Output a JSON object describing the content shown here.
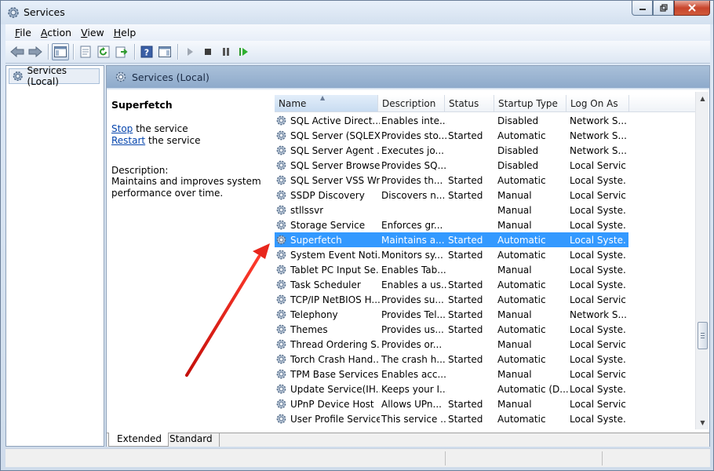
{
  "window": {
    "title": "Services"
  },
  "menu": [
    {
      "label": "File",
      "accel": "F"
    },
    {
      "label": "Action",
      "accel": "A"
    },
    {
      "label": "View",
      "accel": "V"
    },
    {
      "label": "Help",
      "accel": "H"
    }
  ],
  "tree": {
    "root_label": "Services (Local)"
  },
  "content": {
    "header": "Services (Local)"
  },
  "details": {
    "service_name": "Superfetch",
    "stop_link": "Stop",
    "stop_suffix": " the service",
    "restart_link": "Restart",
    "restart_suffix": " the service",
    "description_label": "Description:",
    "description": "Maintains and improves system performance over time."
  },
  "columns": {
    "name": "Name",
    "description": "Description",
    "status": "Status",
    "startup_type": "Startup Type",
    "log_on_as": "Log On As"
  },
  "services": [
    {
      "name": "SQL Active Direct...",
      "description": "Enables inte...",
      "status": "",
      "startup": "Disabled",
      "logon": "Network S..."
    },
    {
      "name": "SQL Server (SQLEX...",
      "description": "Provides sto...",
      "status": "Started",
      "startup": "Automatic",
      "logon": "Network S..."
    },
    {
      "name": "SQL Server Agent ...",
      "description": "Executes jo...",
      "status": "",
      "startup": "Disabled",
      "logon": "Network S..."
    },
    {
      "name": "SQL Server Browser",
      "description": "Provides SQ...",
      "status": "",
      "startup": "Disabled",
      "logon": "Local Service"
    },
    {
      "name": "SQL Server VSS Wr...",
      "description": "Provides th...",
      "status": "Started",
      "startup": "Automatic",
      "logon": "Local Syste..."
    },
    {
      "name": "SSDP Discovery",
      "description": "Discovers n...",
      "status": "Started",
      "startup": "Manual",
      "logon": "Local Service"
    },
    {
      "name": "stllssvr",
      "description": "",
      "status": "",
      "startup": "Manual",
      "logon": "Local Syste..."
    },
    {
      "name": "Storage Service",
      "description": "Enforces gr...",
      "status": "",
      "startup": "Manual",
      "logon": "Local Syste..."
    },
    {
      "name": "Superfetch",
      "description": "Maintains a...",
      "status": "Started",
      "startup": "Automatic",
      "logon": "Local Syste...",
      "selected": true
    },
    {
      "name": "System Event Noti...",
      "description": "Monitors sy...",
      "status": "Started",
      "startup": "Automatic",
      "logon": "Local Syste..."
    },
    {
      "name": "Tablet PC Input Se...",
      "description": "Enables Tab...",
      "status": "",
      "startup": "Manual",
      "logon": "Local Syste..."
    },
    {
      "name": "Task Scheduler",
      "description": "Enables a us...",
      "status": "Started",
      "startup": "Automatic",
      "logon": "Local Syste..."
    },
    {
      "name": "TCP/IP NetBIOS H...",
      "description": "Provides su...",
      "status": "Started",
      "startup": "Automatic",
      "logon": "Local Service"
    },
    {
      "name": "Telephony",
      "description": "Provides Tel...",
      "status": "Started",
      "startup": "Manual",
      "logon": "Network S..."
    },
    {
      "name": "Themes",
      "description": "Provides us...",
      "status": "Started",
      "startup": "Automatic",
      "logon": "Local Syste..."
    },
    {
      "name": "Thread Ordering S...",
      "description": "Provides or...",
      "status": "",
      "startup": "Manual",
      "logon": "Local Service"
    },
    {
      "name": "Torch Crash Hand...",
      "description": "The crash h...",
      "status": "Started",
      "startup": "Automatic",
      "logon": "Local Syste..."
    },
    {
      "name": "TPM Base Services",
      "description": "Enables acc...",
      "status": "",
      "startup": "Manual",
      "logon": "Local Service"
    },
    {
      "name": "Update Service(IH...",
      "description": "Keeps your I...",
      "status": "",
      "startup": "Automatic (D...",
      "logon": "Local Syste..."
    },
    {
      "name": "UPnP Device Host",
      "description": "Allows UPn...",
      "status": "Started",
      "startup": "Manual",
      "logon": "Local Service"
    },
    {
      "name": "User Profile Service",
      "description": "This service ...",
      "status": "Started",
      "startup": "Automatic",
      "logon": "Local Syste..."
    }
  ],
  "tabs": [
    "Extended",
    "Standard"
  ],
  "annotation": {
    "arrow_color": "#e8261c"
  },
  "colors": {
    "selection": "#3399ff",
    "header": "#9bb6d3"
  }
}
